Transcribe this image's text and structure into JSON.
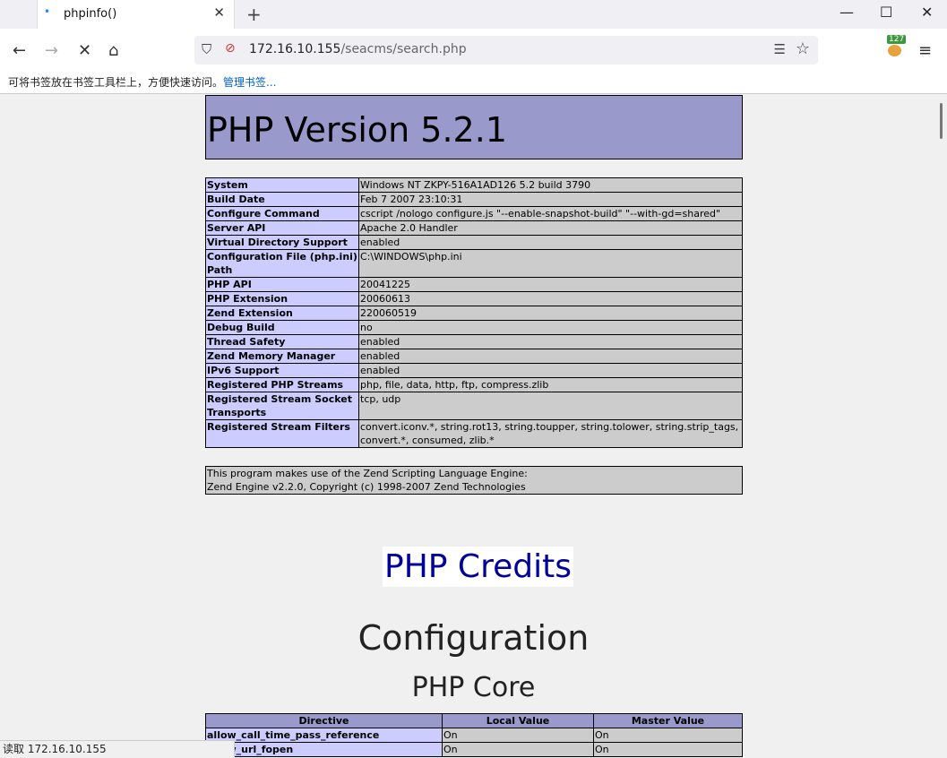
{
  "browser": {
    "tab_title": "phpinfo()",
    "tab_close": "✕",
    "new_tab": "+",
    "window": {
      "minimize": "—",
      "maximize": "☐",
      "close": "✕"
    },
    "nav": {
      "back": "←",
      "forward": "→",
      "stop": "✕",
      "home": "⌂"
    },
    "url_host": "172.16.10.155",
    "url_path": "/seacms/search.php",
    "ext_badge": "127",
    "bookmarks_hint": "可将书签放在书签工具栏上，方便快速访问。",
    "bookmarks_link": "管理书签...",
    "status_text": "读取 172.16.10.155"
  },
  "page": {
    "title": "PHP Version 5.2.1",
    "system_info": [
      {
        "key": "System",
        "value": "Windows NT ZKPY-516A1AD126 5.2 build 3790"
      },
      {
        "key": "Build Date",
        "value": "Feb 7 2007 23:10:31"
      },
      {
        "key": "Configure Command",
        "value": "cscript /nologo configure.js \"--enable-snapshot-build\" \"--with-gd=shared\""
      },
      {
        "key": "Server API",
        "value": "Apache 2.0 Handler"
      },
      {
        "key": "Virtual Directory Support",
        "value": "enabled"
      },
      {
        "key": "Configuration File (php.ini) Path",
        "value": "C:\\WINDOWS\\php.ini"
      },
      {
        "key": "PHP API",
        "value": "20041225"
      },
      {
        "key": "PHP Extension",
        "value": "20060613"
      },
      {
        "key": "Zend Extension",
        "value": "220060519"
      },
      {
        "key": "Debug Build",
        "value": "no"
      },
      {
        "key": "Thread Safety",
        "value": "enabled"
      },
      {
        "key": "Zend Memory Manager",
        "value": "enabled"
      },
      {
        "key": "IPv6 Support",
        "value": "enabled"
      },
      {
        "key": "Registered PHP Streams",
        "value": "php, file, data, http, ftp, compress.zlib"
      },
      {
        "key": "Registered Stream Socket Transports",
        "value": "tcp, udp"
      },
      {
        "key": "Registered Stream Filters",
        "value": "convert.iconv.*, string.rot13, string.toupper, string.tolower, string.strip_tags, convert.*, consumed, zlib.*"
      }
    ],
    "zend_line1": "This program makes use of the Zend Scripting Language Engine:",
    "zend_line2": "Zend Engine v2.2.0, Copyright (c) 1998-2007 Zend Technologies",
    "credits": "PHP Credits",
    "configuration": "Configuration",
    "php_core": "PHP Core",
    "core_headers": [
      "Directive",
      "Local Value",
      "Master Value"
    ],
    "core_rows": [
      {
        "directive": "allow_call_time_pass_reference",
        "local": "On",
        "master": "On"
      },
      {
        "directive": "allow_url_fopen",
        "local": "On",
        "master": "On"
      }
    ]
  }
}
